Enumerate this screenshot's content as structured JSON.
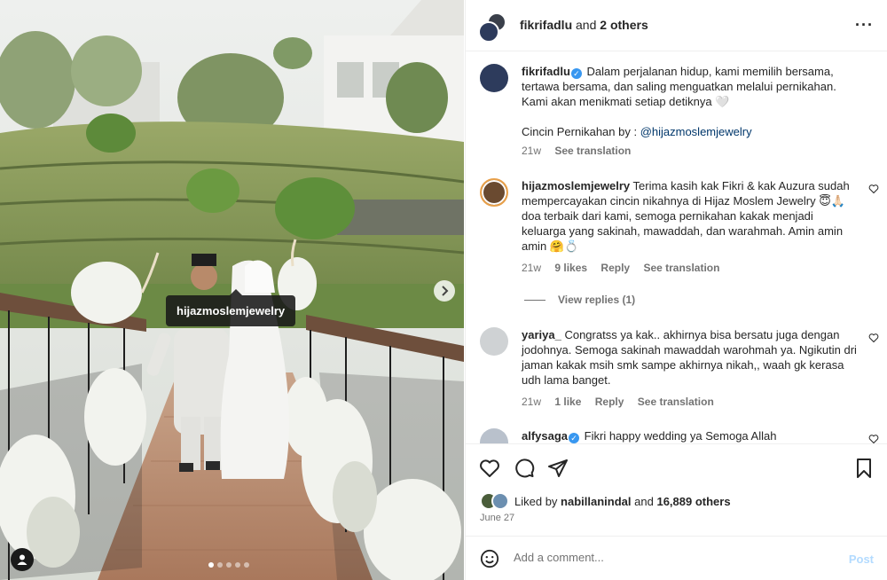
{
  "photo": {
    "tag_label": "hijazmoslemjewelry",
    "slide_count": 5,
    "active_slide": 1
  },
  "header": {
    "username": "fikrifadlu",
    "collab_suffix": "and",
    "collab_others": "2 others",
    "more_icon": "more-horizontal-icon"
  },
  "caption": {
    "username": "fikrifadlu",
    "text": "Dalam perjalanan hidup, kami memilih bersama, tertawa bersama, dan saling menguatkan melalui pernikahan. Kami akan menikmati setiap detiknya 🤍",
    "line2_prefix": "Cincin Pernikahan by : ",
    "line2_link": "@hijazmoslemjewelry",
    "time": "21w",
    "translate": "See translation"
  },
  "comments": [
    {
      "username": "hijazmoslemjewelry",
      "text": "Terima kasih kak Fikri & kak Auzura sudah mempercayakan cincin nikahnya di Hijaz Moslem Jewelry 😇🙏🏻 doa terbaik dari kami, semoga pernikahan kakak menjadi keluarga yang sakinah, mawaddah, dan warahmah. Amin amin amin 🤗💍",
      "time": "21w",
      "likes": "9 likes",
      "reply": "Reply",
      "translate": "See translation",
      "view_replies": "View replies (1)"
    },
    {
      "username": "yariya_",
      "text": "Congratss ya kak.. akhirnya bisa bersatu juga dengan jodohnya. Semoga sakinah mawaddah warohmah ya. Ngikutin dri jaman kakak msih smk sampe akhirnya nikah,, waah gk kerasa udh lama banget.",
      "time": "21w",
      "likes": "1 like",
      "reply": "Reply",
      "translate": "See translation"
    },
    {
      "username": "alfysaga",
      "text": "Fikri happy wedding ya Semoga Allah"
    }
  ],
  "actions": {
    "like_icon": "heart-icon",
    "comment_icon": "comment-icon",
    "share_icon": "share-icon",
    "save_icon": "bookmark-icon",
    "liked_prefix": "Liked by",
    "liked_user": "nabillanindal",
    "liked_and": "and",
    "liked_others": "16,889 others",
    "date": "June 27"
  },
  "add_comment": {
    "placeholder": "Add a comment...",
    "post_label": "Post"
  },
  "colors": {
    "accent_link": "#00376b",
    "verified": "#3897f0",
    "post_disabled": "#b3dbff",
    "secondary_text": "#737373"
  }
}
